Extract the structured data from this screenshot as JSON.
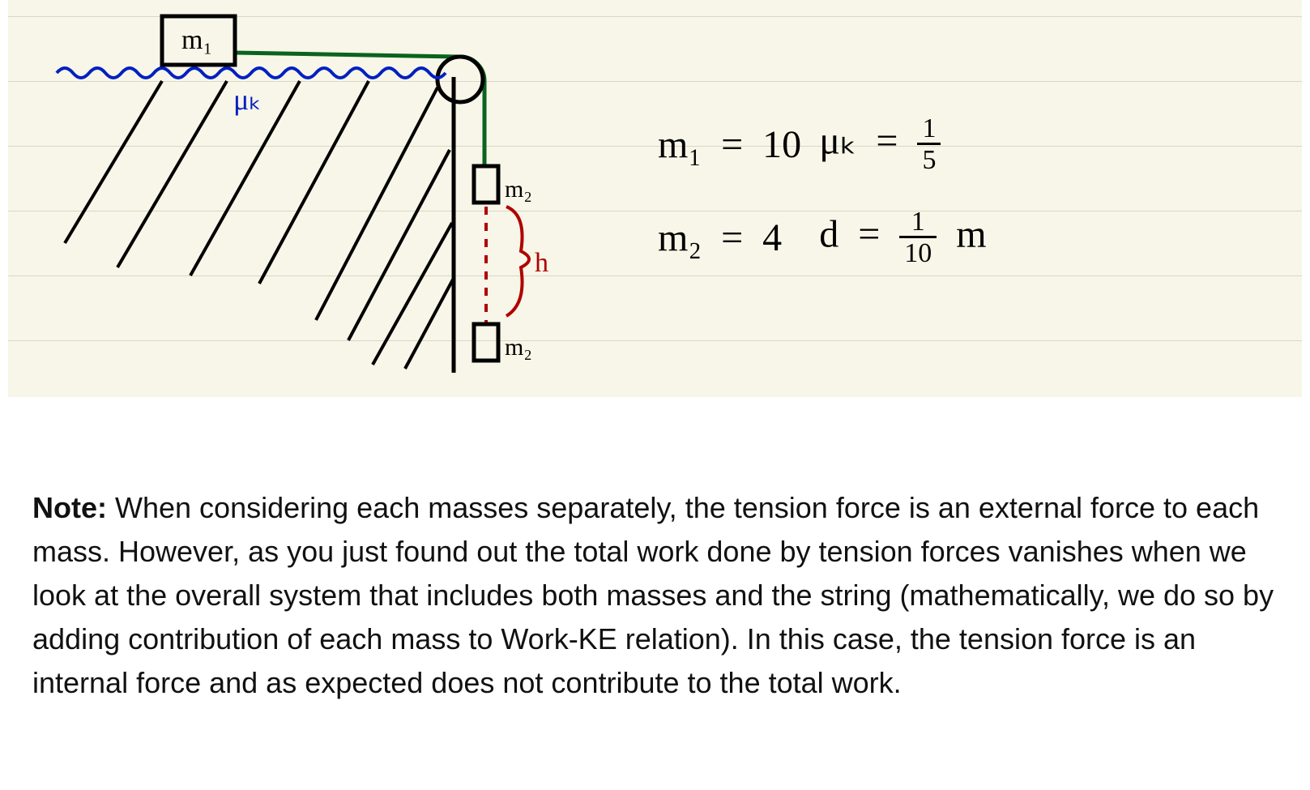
{
  "diagram": {
    "block_top_label": "m₁",
    "friction_label": "μₖ",
    "hanging_label_upper": "m₂",
    "hanging_label_lower": "m₂",
    "height_label": "h"
  },
  "values": {
    "m1": {
      "name": "m₁",
      "eq": "=",
      "val": "10"
    },
    "m2": {
      "name": "m₂",
      "eq": "=",
      "val": "4"
    },
    "muk": {
      "name": "μₖ",
      "eq": "=",
      "num": "1",
      "den": "5"
    },
    "d": {
      "name": "d",
      "eq": "=",
      "num": "1",
      "den": "10",
      "unit": "m"
    }
  },
  "note": {
    "lead": "Note:",
    "body": " When considering each masses separately, the tension force is an external force to each mass. However, as you just found out the total work done by tension forces vanishes when we look at the overall system that includes both masses and the string (mathematically, we do so by adding contribution of each mass to Work-KE relation). In this case, the tension force is an internal force and as expected does not contribute to the total work."
  }
}
